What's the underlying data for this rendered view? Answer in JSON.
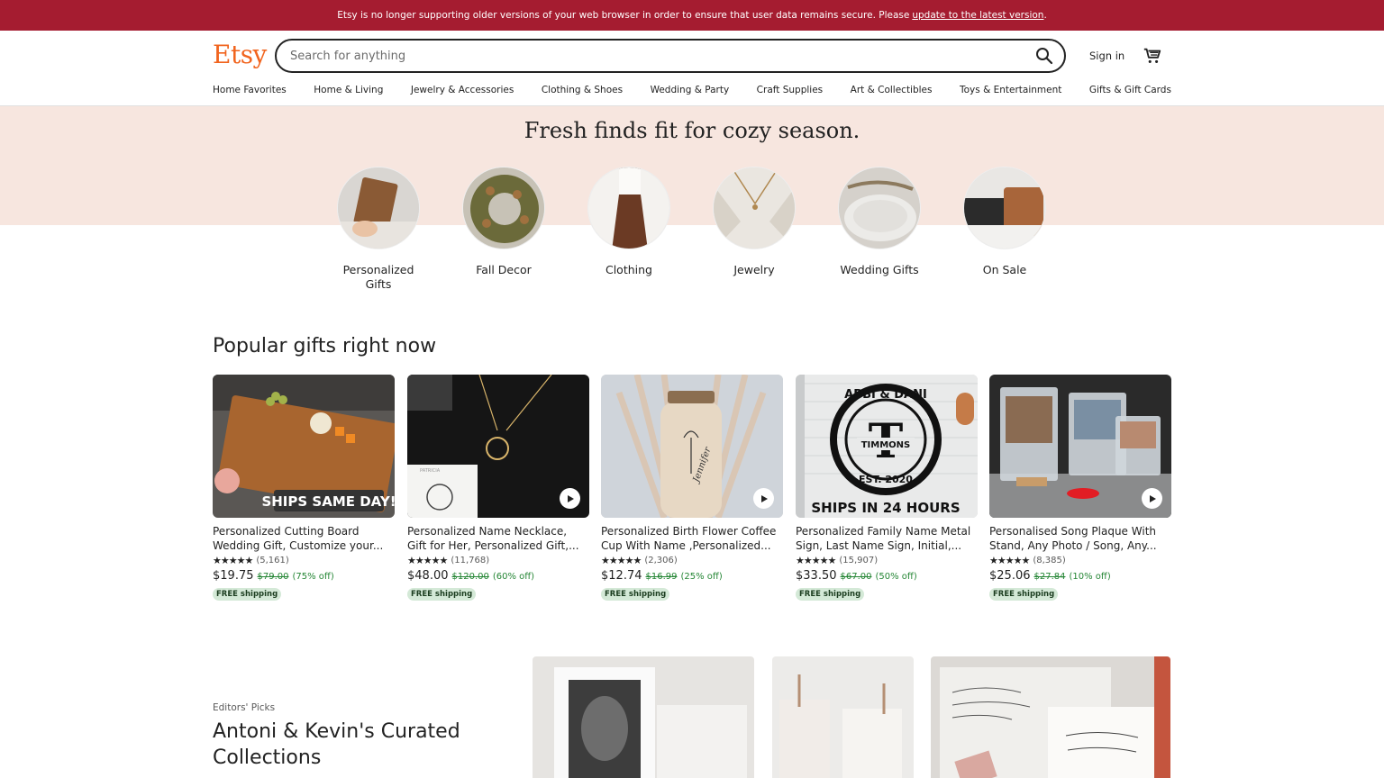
{
  "banner": {
    "message": "Etsy is no longer supporting older versions of your web browser in order to ensure that user data remains secure. Please",
    "link": "update to the latest version",
    "end": "."
  },
  "header": {
    "logo": "Etsy",
    "search_placeholder": "Search for anything",
    "signin": "Sign in"
  },
  "nav": [
    "Home Favorites",
    "Home & Living",
    "Jewelry & Accessories",
    "Clothing & Shoes",
    "Wedding & Party",
    "Craft Supplies",
    "Art & Collectibles",
    "Toys & Entertainment",
    "Gifts & Gift Cards"
  ],
  "hero": {
    "title": "Fresh finds fit for cozy season.",
    "categories": [
      {
        "label": "Personalized Gifts"
      },
      {
        "label": "Fall Decor"
      },
      {
        "label": "Clothing"
      },
      {
        "label": "Jewelry"
      },
      {
        "label": "Wedding Gifts"
      },
      {
        "label": "On Sale"
      }
    ]
  },
  "popular": {
    "title": "Popular gifts right now",
    "products": [
      {
        "title": "Personalized Cutting Board Wedding Gift, Customize your...",
        "stars": "★★★★★",
        "reviews": "(5,161)",
        "price": "$19.75",
        "orig": "$79.00",
        "off": "(75% off)",
        "ship": "FREE shipping",
        "overlay": "SHIPS SAME DAY!"
      },
      {
        "title": "Personalized Name Necklace, Gift for Her, Personalized Gift,...",
        "stars": "★★★★★",
        "reviews": "(11,768)",
        "price": "$48.00",
        "orig": "$120.00",
        "off": "(60% off)",
        "ship": "FREE shipping",
        "overlay": "PATRICIA"
      },
      {
        "title": "Personalized Birth Flower Coffee Cup With Name ,Personalized...",
        "stars": "★★★★★",
        "reviews": "(2,306)",
        "price": "$12.74",
        "orig": "$16.99",
        "off": "(25% off)",
        "ship": "FREE shipping",
        "overlay": "Jennifer"
      },
      {
        "title": "Personalized Family Name Metal Sign, Last Name Sign, Initial,...",
        "stars": "★★★★★",
        "reviews": "(15,907)",
        "price": "$33.50",
        "orig": "$67.00",
        "off": "(50% off)",
        "ship": "FREE shipping",
        "overlay": "SHIPS IN 24 HOURS",
        "sign_top": "ABBI & DANI",
        "sign_letter": "T",
        "sign_name": "TIMMONS",
        "sign_est": "EST. 2020"
      },
      {
        "title": "Personalised Song Plaque With Stand, Any Photo / Song, Any...",
        "stars": "★★★★★",
        "reviews": "(8,385)",
        "price": "$25.06",
        "orig": "$27.84",
        "off": "(10% off)",
        "ship": "FREE shipping"
      }
    ]
  },
  "editors": {
    "label": "Editors' Picks",
    "title": "Antoni & Kevin's Curated Collections"
  },
  "colors": {
    "brand": "#f1641e",
    "banner": "#a51c30",
    "hero_bg": "#f7e6df",
    "sale_green": "#258635"
  }
}
